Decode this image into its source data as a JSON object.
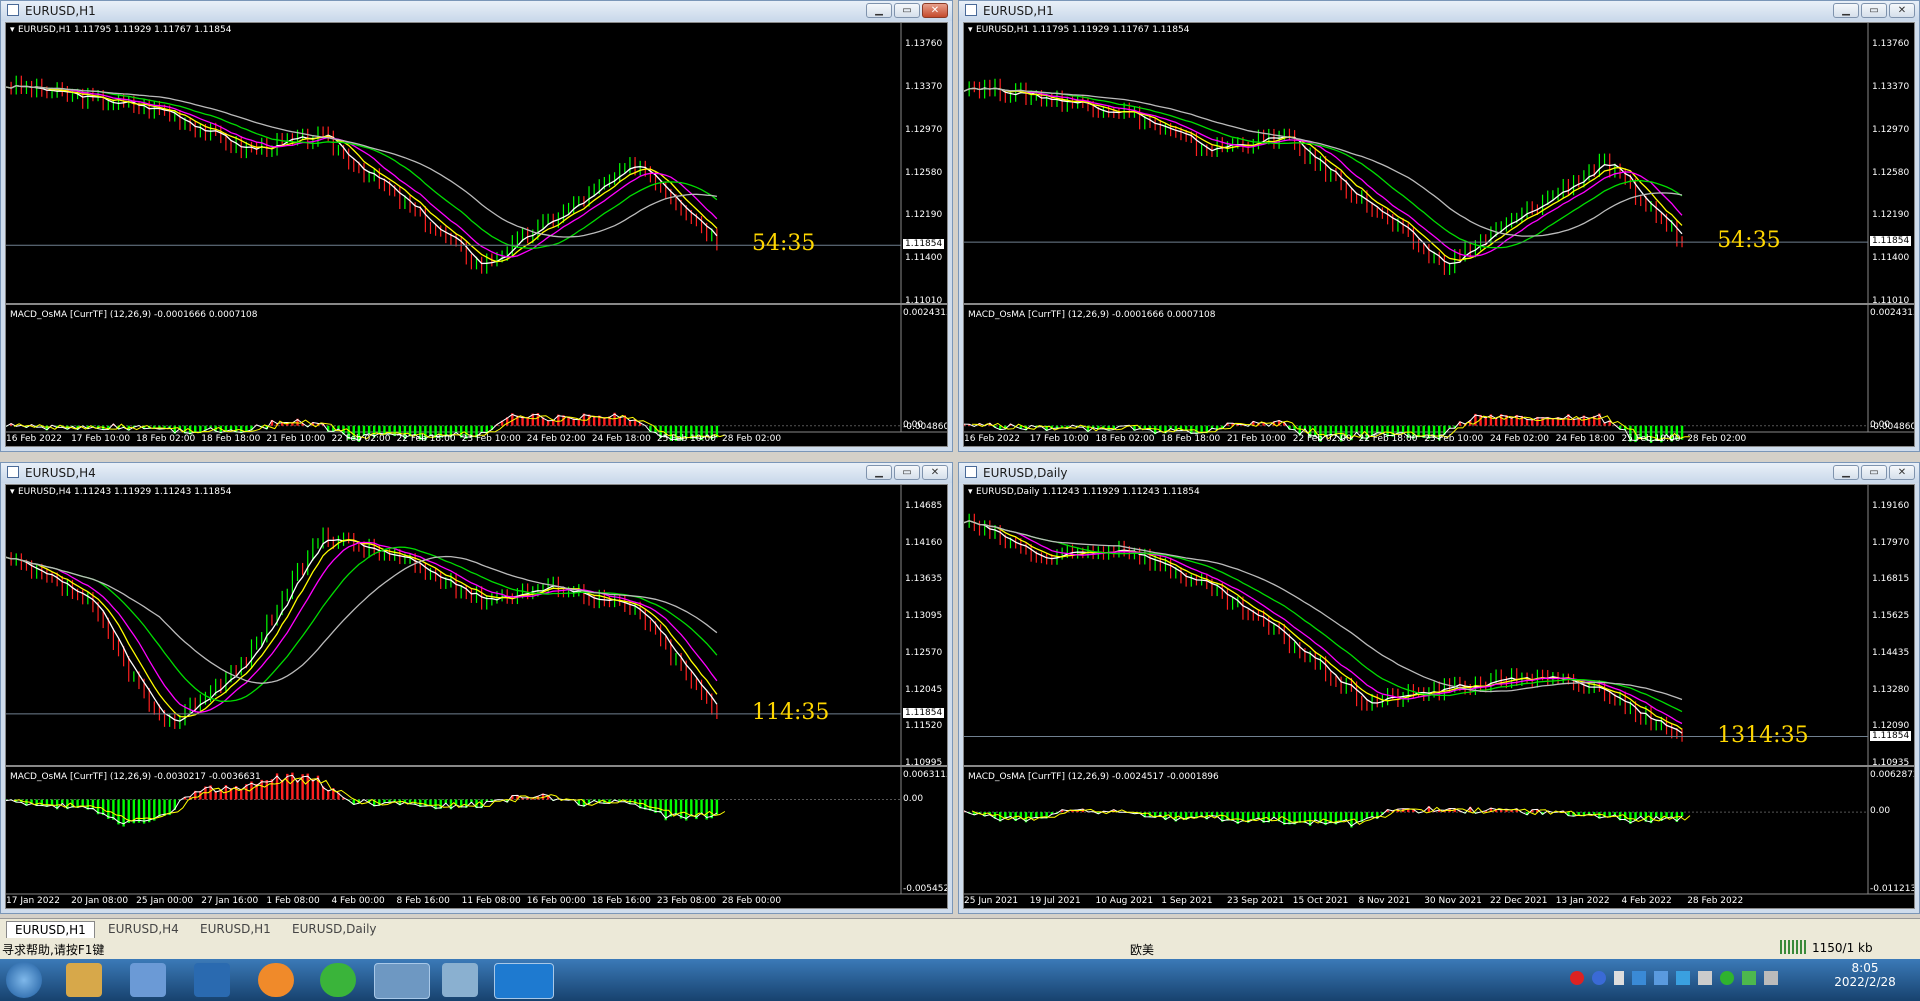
{
  "windows": [
    {
      "title": "EURUSD,H1",
      "header": "EURUSD,H1  1.11795 1.11929 1.11767 1.11854",
      "macd": "MACD_OsMA [CurrTF] (12,26,9) -0.0001666 0.0007108",
      "prices": [
        "1.13760",
        "1.13370",
        "1.12970",
        "1.12580",
        "1.12190",
        "1.11400",
        "1.11010"
      ],
      "current": "1.11854",
      "timer": "54:35",
      "macd_ticks": [
        "0.0024313",
        "0.00",
        "-0.0048600"
      ],
      "dates": [
        "16 Feb 2022",
        "17 Feb 10:00",
        "18 Feb 02:00",
        "18 Feb 18:00",
        "21 Feb 10:00",
        "22 Feb 02:00",
        "22 Feb 18:00",
        "23 Feb 10:00",
        "24 Feb 02:00",
        "24 Feb 18:00",
        "25 Feb 10:00",
        "28 Feb 02:00"
      ]
    },
    {
      "title": "EURUSD,H1",
      "header": "EURUSD,H1  1.11795 1.11929 1.11767 1.11854",
      "macd": "MACD_OsMA [CurrTF] (12,26,9) -0.0001666 0.0007108",
      "prices": [
        "1.13760",
        "1.13370",
        "1.12970",
        "1.12580",
        "1.12190",
        "1.11400",
        "1.11010"
      ],
      "current": "1.11854",
      "timer": "54:35",
      "macd_ticks": [
        "0.0024313",
        "0.00",
        "-0.0048600"
      ],
      "dates": [
        "16 Feb 2022",
        "17 Feb 10:00",
        "18 Feb 02:00",
        "18 Feb 18:00",
        "21 Feb 10:00",
        "22 Feb 02:00",
        "22 Feb 18:00",
        "23 Feb 10:00",
        "24 Feb 02:00",
        "24 Feb 18:00",
        "25 Feb 10:00",
        "28 Feb 02:00"
      ]
    },
    {
      "title": "EURUSD,H4",
      "header": "EURUSD,H4  1.11243 1.11929 1.11243 1.11854",
      "macd": "MACD_OsMA [CurrTF] (12,26,9) -0.0030217 -0.0036631",
      "prices": [
        "1.14685",
        "1.14160",
        "1.13635",
        "1.13095",
        "1.12570",
        "1.12045",
        "1.11520",
        "1.10995"
      ],
      "current": "1.11854",
      "timer": "114:35",
      "macd_ticks": [
        "0.0063115",
        "0.00",
        "-0.005452"
      ],
      "dates": [
        "17 Jan 2022",
        "20 Jan 08:00",
        "25 Jan 00:00",
        "27 Jan 16:00",
        "1 Feb 08:00",
        "4 Feb 00:00",
        "8 Feb 16:00",
        "11 Feb 08:00",
        "16 Feb 00:00",
        "18 Feb 16:00",
        "23 Feb 08:00",
        "28 Feb 00:00"
      ]
    },
    {
      "title": "EURUSD,Daily",
      "header": "EURUSD,Daily  1.11243 1.11929 1.11243 1.11854",
      "macd": "MACD_OsMA [CurrTF] (12,26,9) -0.0024517 -0.0001896",
      "prices": [
        "1.19160",
        "1.17970",
        "1.16815",
        "1.15625",
        "1.14435",
        "1.13280",
        "1.12090",
        "1.10935"
      ],
      "current": "1.11854",
      "timer": "1314:35",
      "macd_ticks": [
        "0.0062872",
        "0.00",
        "-0.011213"
      ],
      "dates": [
        "25 Jun 2021",
        "19 Jul 2021",
        "10 Aug 2021",
        "1 Sep 2021",
        "23 Sep 2021",
        "15 Oct 2021",
        "8 Nov 2021",
        "30 Nov 2021",
        "22 Dec 2021",
        "13 Jan 2022",
        "4 Feb 2022",
        "28 Feb 2022"
      ]
    }
  ],
  "tabs": [
    "EURUSD,H1",
    "EURUSD,H4",
    "EURUSD,H1",
    "EURUSD,Daily"
  ],
  "status": {
    "help": "寻求帮助,请按F1键",
    "profile": "欧美",
    "net": "1150/1 kb"
  },
  "clock": {
    "time": "8:05",
    "date": "2022/2/28"
  }
}
